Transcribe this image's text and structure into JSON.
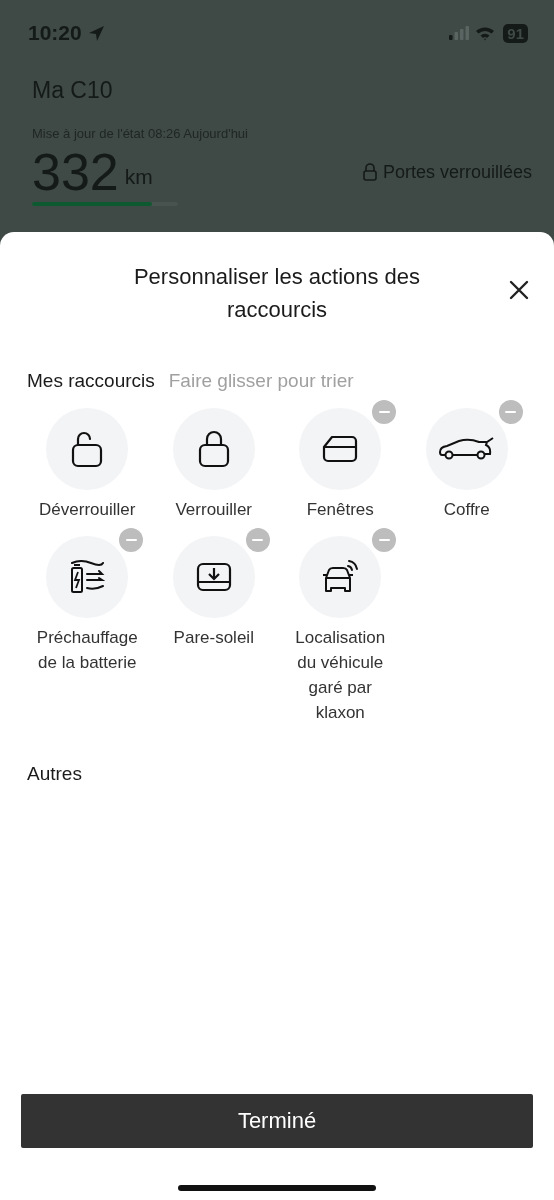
{
  "status_bar": {
    "time": "10:20",
    "battery": "91"
  },
  "background": {
    "car_name": "Ma C10",
    "updated": "Mise à jour de l'état 08:26 Aujourd'hui",
    "range": "332",
    "range_unit": "km",
    "level": 0.82,
    "doors": "Portes verrouillées"
  },
  "sheet": {
    "title": "Personnaliser les actions des raccourcis",
    "my_shortcuts": {
      "title": "Mes raccourcis",
      "hint": "Faire glisser pour trier",
      "items": [
        {
          "label": "Déverrouiller",
          "kind": "unlock",
          "removable": false
        },
        {
          "label": "Verrouiller",
          "kind": "lock",
          "removable": false
        },
        {
          "label": "Fenêtres",
          "kind": "window",
          "removable": true
        },
        {
          "label": "Coffre",
          "kind": "trunk",
          "removable": true
        },
        {
          "label": "Préchauffage de la batterie",
          "kind": "battery",
          "removable": true
        },
        {
          "label": "Pare-soleil",
          "kind": "sunshade",
          "removable": true
        },
        {
          "label": "Localisation du véhicule garé par klaxon",
          "kind": "horn",
          "removable": true
        }
      ]
    },
    "others": {
      "title": "Autres"
    },
    "done_button": "Terminé"
  }
}
